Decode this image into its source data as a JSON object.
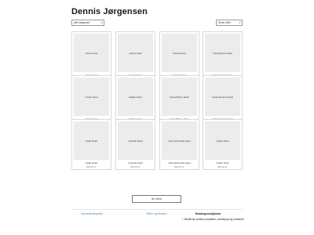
{
  "header": {
    "title": "Dennis Jørgensen"
  },
  "filters": {
    "category": {
      "value": "Alle kategorier"
    },
    "sort": {
      "value": "Sorter efter"
    }
  },
  "products": [
    {
      "image_label": "Azure hotel",
      "name": "Azure hotel",
      "price": "999,00 kr."
    },
    {
      "image_label": "Ascott hotel",
      "name": "Ascott hotel",
      "price": "999,00 kr."
    },
    {
      "image_label": "Astoria hotel",
      "name": "Astoria hotel",
      "price": "999,00 kr."
    },
    {
      "image_label": "City Express Hotel",
      "name": "City Express Hotel",
      "price": "999,00 kr."
    },
    {
      "image_label": "Crown hotel",
      "name": "Crown hotel",
      "price": "999,00 kr."
    },
    {
      "image_label": "Dallas Hotel",
      "name": "Dallas Hotel",
      "price": "999,00 kr."
    },
    {
      "image_label": "Grand Place Hotel",
      "name": "Grand Place Hotel",
      "price": "999,00 kr."
    },
    {
      "image_label": "Hotel Grand Central",
      "name": "Hotel Grand Central",
      "price": "999,00 kr."
    },
    {
      "image_label": "Hyatt Hotel",
      "name": "Hyatt Hotel",
      "price": "999,00 kr."
    },
    {
      "image_label": "Imperial Hotel",
      "name": "Imperial Hotel",
      "price": "999,00 kr."
    },
    {
      "image_label": "Intercontinental Hotel",
      "name": "Intercontinental Hotel",
      "price": "999,00 kr."
    },
    {
      "image_label": "Japan hotel",
      "name": "Japan hotel",
      "price": "999,00 kr."
    }
  ],
  "actions": {
    "load_more": "Se mere"
  },
  "footer": {
    "link_terms": "Handelsbetingelser",
    "link_shipping": "Sikker og fleksibel",
    "heading": "Betalingsmuligheder",
    "list": [
      "Bestill de samme produkter, mobilepay og kontanter"
    ]
  }
}
